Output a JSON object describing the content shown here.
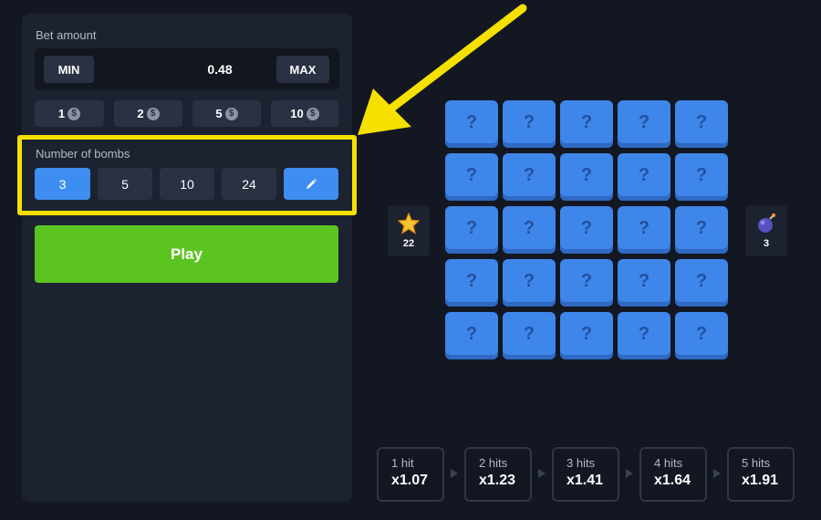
{
  "bet": {
    "label": "Bet amount",
    "min_label": "MIN",
    "value": "0.48",
    "max_label": "MAX",
    "presets": [
      "1",
      "2",
      "5",
      "10"
    ],
    "coin_symbol": "$"
  },
  "bombs": {
    "label": "Number of bombs",
    "options": [
      "3",
      "5",
      "10",
      "24"
    ],
    "selected": "3",
    "edit_icon": "pencil-icon"
  },
  "play_label": "Play",
  "board": {
    "tile_symbol": "?",
    "stars_count": "22",
    "bombs_count": "3"
  },
  "multipliers": [
    {
      "hits": "1 hit",
      "mult": "x1.07"
    },
    {
      "hits": "2 hits",
      "mult": "x1.23"
    },
    {
      "hits": "3 hits",
      "mult": "x1.41"
    },
    {
      "hits": "4 hits",
      "mult": "x1.64"
    },
    {
      "hits": "5 hits",
      "mult": "x1.91"
    }
  ],
  "colors": {
    "accent_blue": "#3d8ef0",
    "play_green": "#5cc421",
    "highlight_yellow": "#f5e000"
  }
}
